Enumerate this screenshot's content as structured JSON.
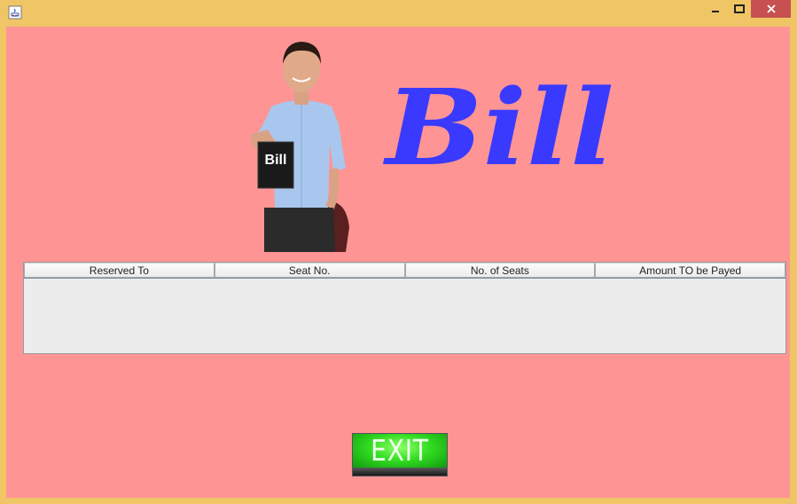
{
  "window": {
    "minimize_label": "",
    "maximize_label": "",
    "close_label": ""
  },
  "header": {
    "sign_text": "Bill",
    "logo_text": "Bill"
  },
  "table": {
    "columns": [
      "Reserved To",
      "Seat No.",
      "No. of Seats",
      "Amount TO be Payed"
    ],
    "rows": []
  },
  "exit_button": {
    "label": "EXIT"
  },
  "colors": {
    "window_border": "#f0c566",
    "content_bg": "#ff9494",
    "logo": "#3a3aff",
    "close": "#c75050"
  }
}
